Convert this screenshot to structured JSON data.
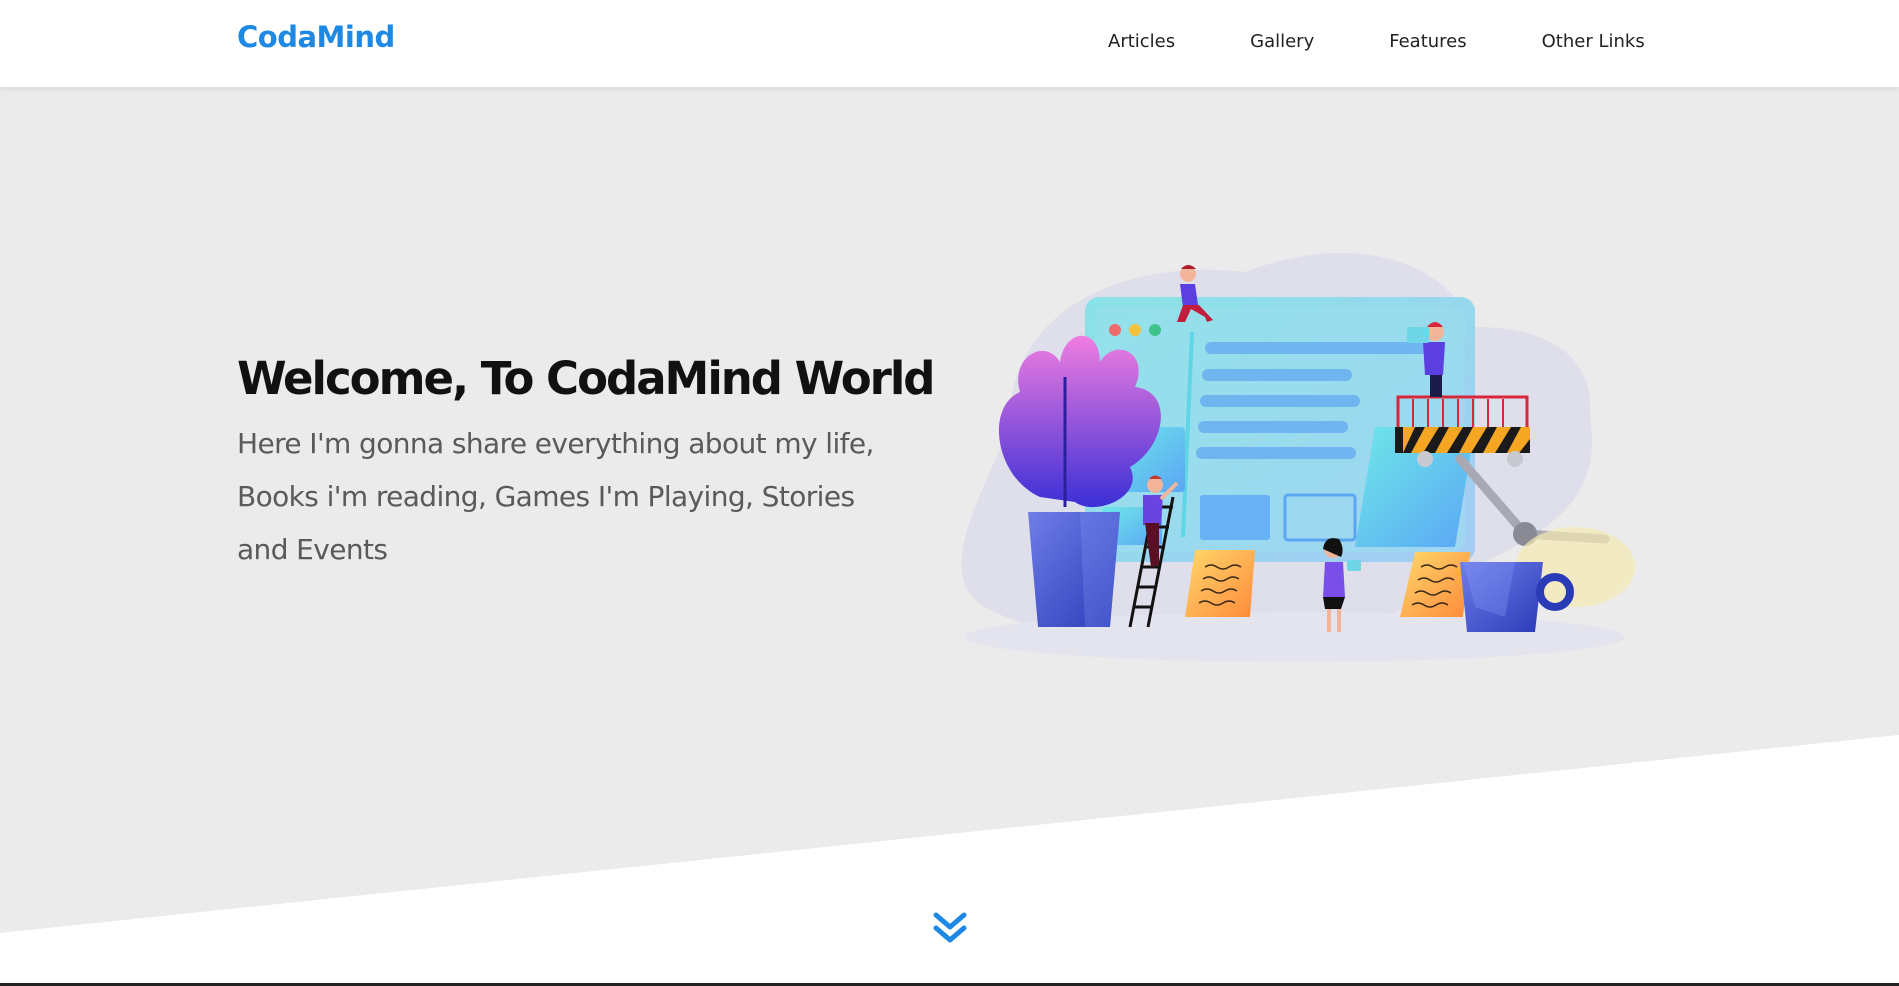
{
  "brand": {
    "name": "CodaMind",
    "color": "#1e88e5"
  },
  "nav": {
    "items": [
      {
        "label": "Articles"
      },
      {
        "label": "Gallery"
      },
      {
        "label": "Features"
      },
      {
        "label": "Other Links"
      }
    ]
  },
  "hero": {
    "title": "Welcome, To CodaMind World",
    "subtitle": "Here I'm gonna share everything about my life, Books i'm reading, Games I'm Playing, Stories and Events",
    "background": "#ebebeb"
  },
  "icons": {
    "scroll_down": "double-chevron-down-icon",
    "illustration": "web-design-team-illustration"
  }
}
